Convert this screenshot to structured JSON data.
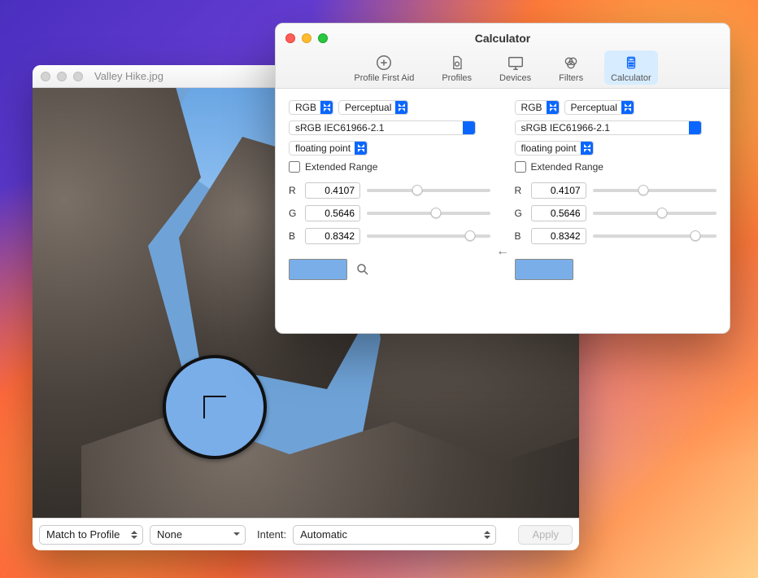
{
  "image_window": {
    "title": "Valley Hike.jpg",
    "footer": {
      "match_label": "Match to Profile",
      "profile_value": "None",
      "intent_label": "Intent:",
      "intent_value": "Automatic",
      "apply_label": "Apply"
    }
  },
  "calc_window": {
    "title": "Calculator",
    "toolbar": [
      {
        "id": "profile-first-aid",
        "label": "Profile First Aid"
      },
      {
        "id": "profiles",
        "label": "Profiles"
      },
      {
        "id": "devices",
        "label": "Devices"
      },
      {
        "id": "filters",
        "label": "Filters"
      },
      {
        "id": "calculator",
        "label": "Calculator",
        "selected": true
      }
    ],
    "direction_glyph": "←",
    "left": {
      "space": "RGB",
      "intent": "Perceptual",
      "profile": "sRGB IEC61966-2.1",
      "format": "floating point",
      "extended_label": "Extended Range",
      "extended": false,
      "channels": {
        "R": "0.4107",
        "G": "0.5646",
        "B": "0.8342"
      },
      "swatch_color": "#7aaee8"
    },
    "right": {
      "space": "RGB",
      "intent": "Perceptual",
      "profile": "sRGB IEC61966-2.1",
      "format": "floating point",
      "extended_label": "Extended Range",
      "extended": false,
      "channels": {
        "R": "0.4107",
        "G": "0.5646",
        "B": "0.8342"
      },
      "swatch_color": "#7aaee8"
    }
  }
}
